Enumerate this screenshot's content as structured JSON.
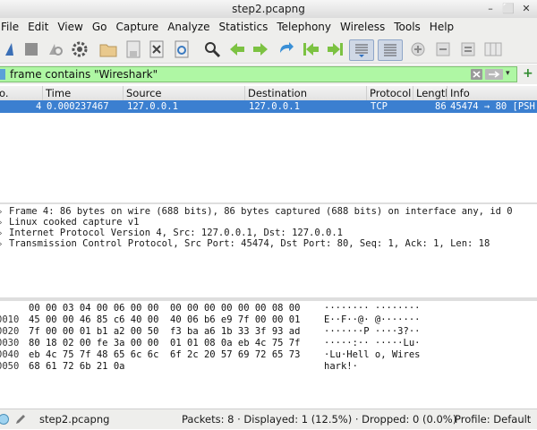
{
  "window": {
    "title": "step2.pcapng"
  },
  "menu": [
    "File",
    "Edit",
    "View",
    "Go",
    "Capture",
    "Analyze",
    "Statistics",
    "Telephony",
    "Wireless",
    "Tools",
    "Help"
  ],
  "filter": {
    "value": "frame contains \"Wireshark\""
  },
  "columns": [
    "o.",
    "Time",
    "Source",
    "Destination",
    "Protocol",
    "Length",
    "Info"
  ],
  "packet": {
    "no": "4",
    "time": "0.000237467",
    "source": "127.0.0.1",
    "destination": "127.0.0.1",
    "protocol": "TCP",
    "length": "86",
    "info": "45474 → 80 [PSH"
  },
  "details": [
    "Frame 4: 86 bytes on wire (688 bits), 86 bytes captured (688 bits) on interface any, id 0",
    "Linux cooked capture v1",
    "Internet Protocol Version 4, Src: 127.0.0.1, Dst: 127.0.0.1",
    "Transmission Control Protocol, Src Port: 45474, Dst Port: 80, Seq: 1, Ack: 1, Len: 18"
  ],
  "bytes": [
    {
      "offset": "",
      "hex": "00 00 03 04 00 06 00 00  00 00 00 00 00 00 08 00",
      "ascii": "········ ········"
    },
    {
      "offset": "0010",
      "hex": "45 00 00 46 85 c6 40 00  40 06 b6 e9 7f 00 00 01",
      "ascii": "E··F··@· @·······"
    },
    {
      "offset": "0020",
      "hex": "7f 00 00 01 b1 a2 00 50  f3 ba a6 1b 33 3f 93 ad",
      "ascii": "·······P ····3?··"
    },
    {
      "offset": "0030",
      "hex": "80 18 02 00 fe 3a 00 00  01 01 08 0a eb 4c 75 7f",
      "ascii": "·····:·· ·····Lu·"
    },
    {
      "offset": "0040",
      "hex": "eb 4c 75 7f 48 65 6c 6c  6f 2c 20 57 69 72 65 73",
      "ascii": "·Lu·Hell o, Wires"
    },
    {
      "offset": "0050",
      "hex": "68 61 72 6b 21 0a",
      "ascii": "hark!·"
    }
  ],
  "status": {
    "file": "step2.pcapng",
    "packets": "Packets: 8 · Displayed: 1 (12.5%) · Dropped: 0 (0.0%)",
    "profile": "Profile: Default"
  },
  "colors": {
    "selection": "#3b7fd0",
    "filter_ok": "#aff7a4"
  }
}
